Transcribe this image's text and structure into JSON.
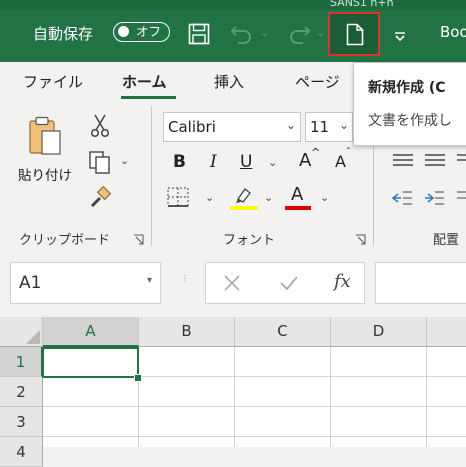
{
  "titlebar": {
    "autosave_label": "自動保存",
    "autosave_state": "オフ",
    "doc_title": "Boo",
    "top_fragment": "SANS1 h+h"
  },
  "ribbon": {
    "tabs": [
      "ファイル",
      "ホーム",
      "挿入",
      "ページ"
    ],
    "active_tab": "ホーム",
    "clipboard": {
      "paste_label": "貼り付け",
      "group_label": "クリップボード"
    },
    "font": {
      "name": "Calibri",
      "size": "11",
      "bold": "B",
      "italic": "I",
      "underline": "U",
      "grow": "A",
      "shrink": "A",
      "color_letter": "A",
      "group_label": "フォント",
      "highlight_color": "#ffff00",
      "font_color": "#e00000"
    },
    "alignment": {
      "group_label": "配置"
    }
  },
  "tooltip": {
    "title": "新規作成 (C",
    "body": "文書を作成し"
  },
  "formula_bar": {
    "name_box": "A1",
    "fx": "fx"
  },
  "sheet": {
    "columns": [
      "A",
      "B",
      "C",
      "D"
    ],
    "rows": [
      "1",
      "2",
      "3",
      "4"
    ],
    "selected_cell": "A1"
  },
  "colors": {
    "excel_green": "#217346",
    "highlight_red": "#e03030"
  }
}
